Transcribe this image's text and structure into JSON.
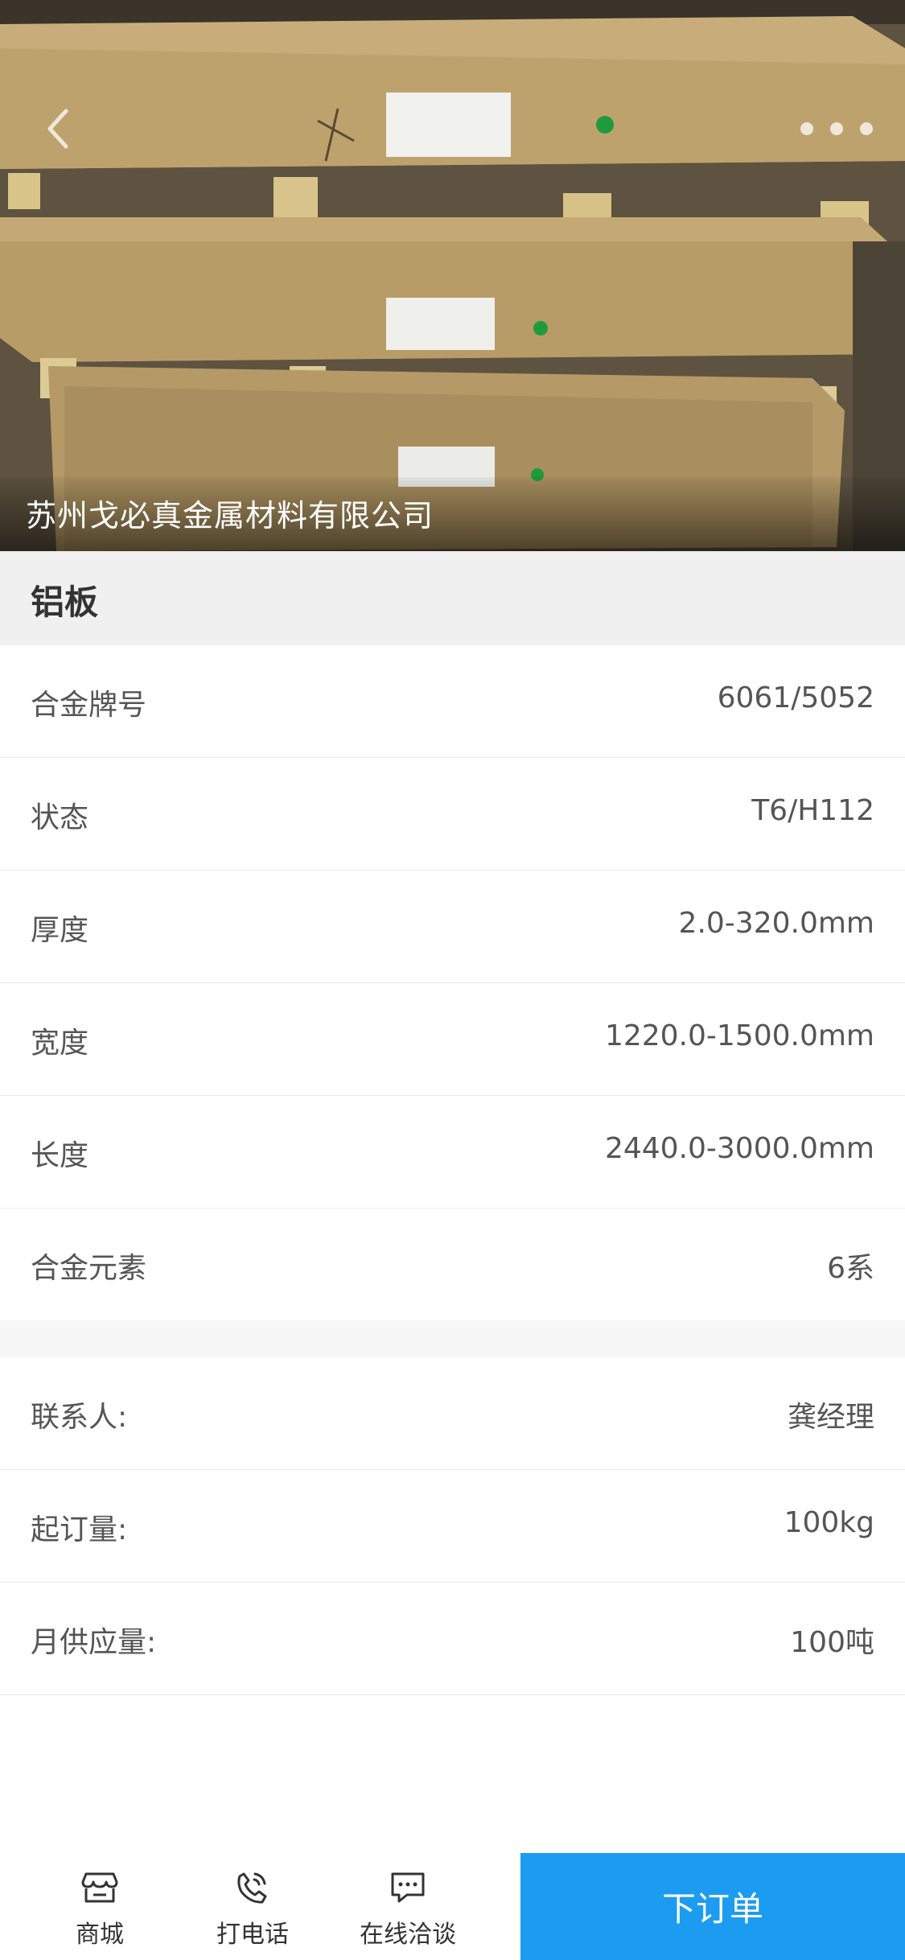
{
  "hero": {
    "company_name": "苏州戈必真金属材料有限公司",
    "back_icon": "chevron-left-icon",
    "more_icon": "more-dots-icon"
  },
  "product": {
    "title": "铝板"
  },
  "specs": [
    {
      "label": "合金牌号",
      "value": "6061/5052"
    },
    {
      "label": "状态",
      "value": "T6/H112"
    },
    {
      "label": "厚度",
      "value": "2.0-320.0mm"
    },
    {
      "label": "宽度",
      "value": "1220.0-1500.0mm"
    },
    {
      "label": "长度",
      "value": "2440.0-3000.0mm"
    },
    {
      "label": "合金元素",
      "value": "6系"
    }
  ],
  "contact": [
    {
      "label": "联系人:",
      "value": "龚经理"
    },
    {
      "label": "起订量:",
      "value": "100kg"
    },
    {
      "label": "月供应量:",
      "value": "100吨"
    }
  ],
  "bottom_bar": {
    "shop_label": "商城",
    "shop_icon": "store-icon",
    "call_label": "打电话",
    "call_icon": "phone-icon",
    "chat_label": "在线洽谈",
    "chat_icon": "chat-bubble-icon",
    "order_label": "下订单"
  },
  "colors": {
    "accent": "#1b9cf0",
    "title_bar_bg": "#f0f0f0"
  }
}
